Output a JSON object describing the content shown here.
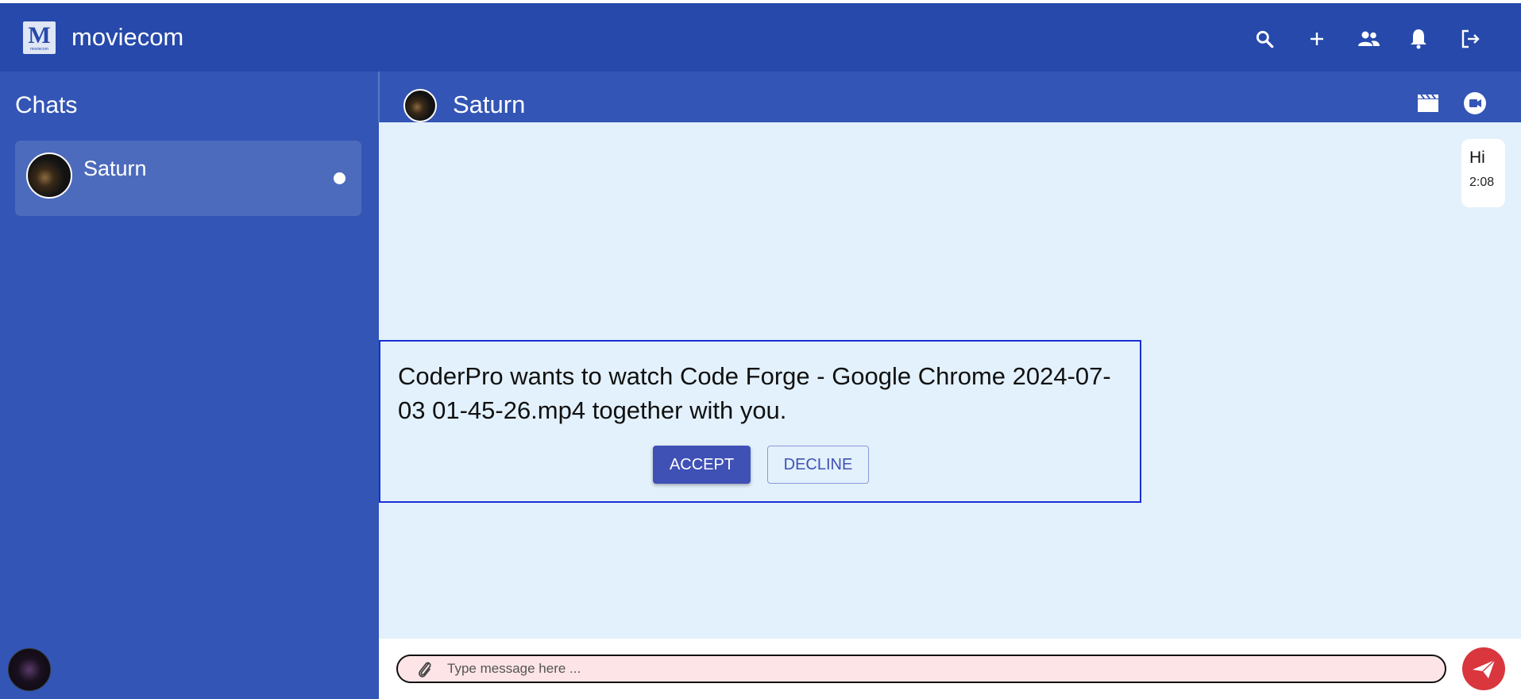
{
  "app": {
    "title": "moviecom",
    "logo_text": "M",
    "logo_subtext": "moviecom"
  },
  "topbar": {
    "icons": [
      "search-icon",
      "add-icon",
      "people-icon",
      "notifications-icon",
      "logout-icon"
    ]
  },
  "sidebar": {
    "title": "Chats",
    "chats": [
      {
        "name": "Saturn",
        "unread": true
      }
    ]
  },
  "chat": {
    "contact_name": "Saturn",
    "header_icons": [
      "movie-icon",
      "video-call-icon"
    ],
    "messages": [
      {
        "text": "Hi",
        "time": "2:08",
        "side": "right"
      }
    ]
  },
  "invite": {
    "text": "CoderPro wants to watch Code Forge - Google Chrome 2024-07-03 01-45-26.mp4 together with you.",
    "accept_label": "ACCEPT",
    "decline_label": "DECLINE"
  },
  "composer": {
    "placeholder": "Type message here ..."
  },
  "colors": {
    "topbar": "#2649ab",
    "sidebar": "#3355b5",
    "chat_bg": "#e3f1fc",
    "accent": "#3f51b5",
    "send": "#d9363e",
    "input_bg": "#fde4e6"
  }
}
